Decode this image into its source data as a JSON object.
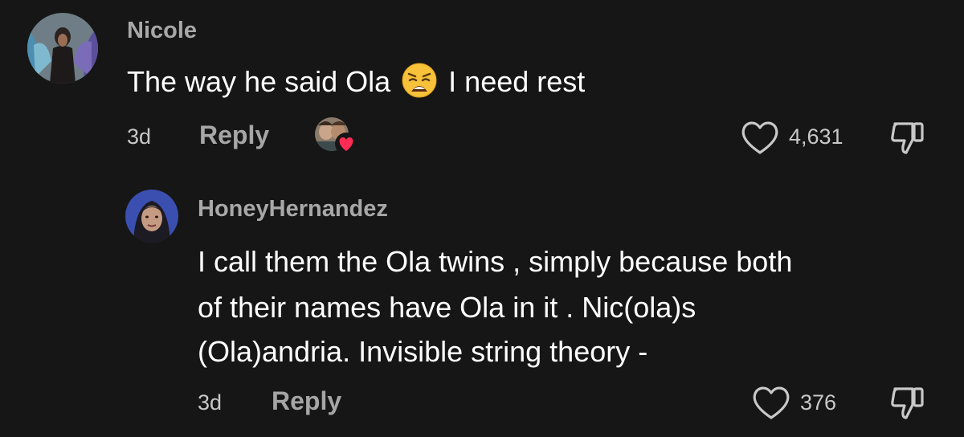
{
  "comments": [
    {
      "username": "Nicole",
      "text_before_emoji": "The way he said Ola",
      "emoji": "weary-face-emoji",
      "text_after_emoji": "I need rest",
      "time": "3d",
      "reply_label": "Reply",
      "likes": "4,631",
      "creator_liked": true
    },
    {
      "username": "HoneyHernandez",
      "text_lines": [
        "I call them the Ola twins , simply because both",
        "of their names have Ola in it . Nic(ola)s",
        "(Ola)andria. Invisible string theory -"
      ],
      "time": "3d",
      "reply_label": "Reply",
      "likes": "376"
    }
  ],
  "colors": {
    "background": "#161616",
    "username": "#a8a8a8",
    "text": "#ffffff",
    "muted": "#c8c8c8",
    "creator_heart": "#fe2c55"
  }
}
